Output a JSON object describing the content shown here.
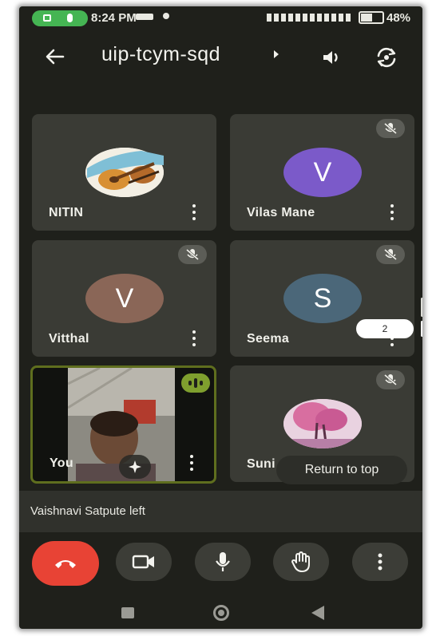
{
  "status_bar": {
    "time": "8:24 PM",
    "battery": "48%"
  },
  "header": {
    "meeting_code": "uip-tcym-sqd"
  },
  "participants": [
    {
      "name": "NITIN",
      "avatar_type": "photo-guitar",
      "muted": false
    },
    {
      "name": "Vilas Mane",
      "initial": "V",
      "avatar_color": "#7b5ac9",
      "muted": true
    },
    {
      "name": "Vitthal",
      "initial": "V",
      "avatar_color": "#8a6657",
      "muted": true
    },
    {
      "name": "Seema",
      "initial": "S",
      "avatar_color": "#4b6779",
      "muted": true
    },
    {
      "name": "You",
      "avatar_type": "camera-video",
      "speaking": true
    },
    {
      "name": "Suni",
      "avatar_type": "photo-pink-tree",
      "muted": true
    }
  ],
  "overflow": {
    "count": "2",
    "return_to_top": "Return to top"
  },
  "notification": {
    "text": "Vaishnavi Satpute left"
  },
  "controls": [
    "end-call",
    "camera",
    "microphone",
    "raise-hand",
    "more"
  ],
  "colors": {
    "background": "#1f201b",
    "tile": "#3a3b35",
    "end_call": "#e84335",
    "speaking_outline": "#7f9f2e"
  }
}
